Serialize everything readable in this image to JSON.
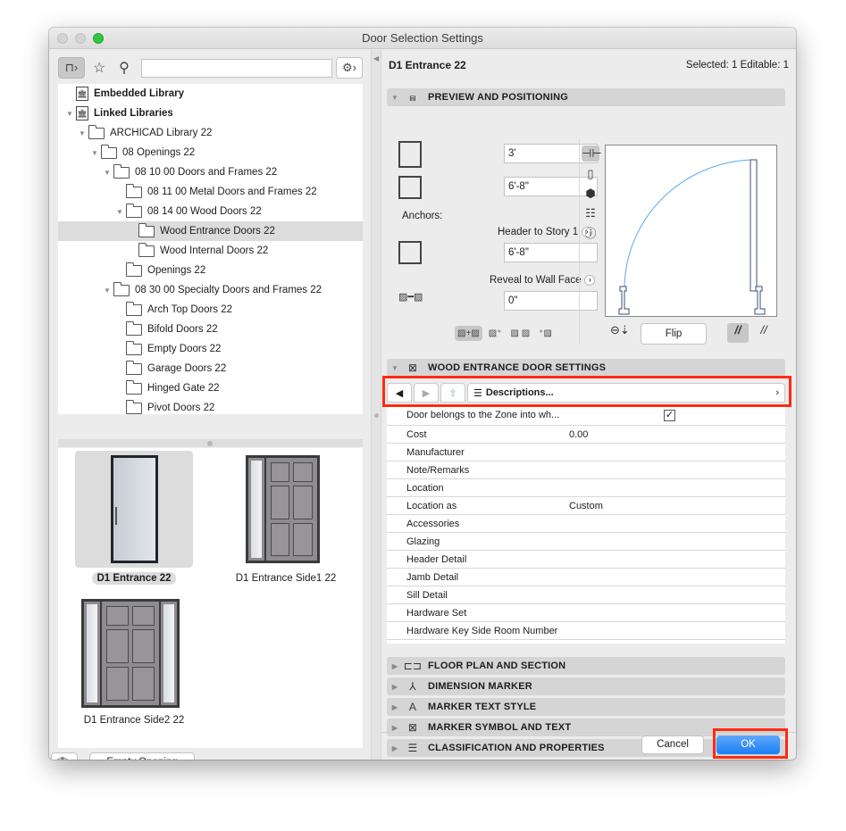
{
  "window": {
    "title": "Door Selection Settings"
  },
  "left": {
    "search": {
      "value": "",
      "placeholder": ""
    },
    "tree": [
      {
        "label": "Embedded Library",
        "level": 0,
        "bold": true,
        "expanded": null,
        "icon": "library-file-icon"
      },
      {
        "label": "Linked Libraries",
        "level": 0,
        "bold": true,
        "expanded": true,
        "icon": "library-folder-icon"
      },
      {
        "label": "ARCHICAD Library 22",
        "level": 1,
        "expanded": true
      },
      {
        "label": "08 Openings 22",
        "level": 2,
        "expanded": true
      },
      {
        "label": "08 10 00 Doors and Frames 22",
        "level": 3,
        "expanded": true
      },
      {
        "label": "08 11 00 Metal Doors and Frames 22",
        "level": 4,
        "expanded": null
      },
      {
        "label": "08 14 00 Wood Doors 22",
        "level": 4,
        "expanded": true
      },
      {
        "label": "Wood Entrance Doors 22",
        "level": 5,
        "expanded": null,
        "selected": true
      },
      {
        "label": "Wood Internal Doors 22",
        "level": 5,
        "expanded": null
      },
      {
        "label": "Openings 22",
        "level": 4,
        "expanded": null
      },
      {
        "label": "08 30 00 Specialty Doors and Frames 22",
        "level": 3,
        "expanded": true
      },
      {
        "label": "Arch Top Doors 22",
        "level": 4,
        "expanded": null
      },
      {
        "label": "Bifold Doors 22",
        "level": 4,
        "expanded": null
      },
      {
        "label": "Empty Doors 22",
        "level": 4,
        "expanded": null
      },
      {
        "label": "Garage Doors 22",
        "level": 4,
        "expanded": null
      },
      {
        "label": "Hinged Gate 22",
        "level": 4,
        "expanded": null
      },
      {
        "label": "Pivot Doors 22",
        "level": 4,
        "expanded": null
      }
    ],
    "thumbnails": [
      {
        "label": "D1 Entrance 22",
        "selected": true
      },
      {
        "label": "D1 Entrance Side1 22",
        "selected": false
      },
      {
        "label": "D1 Entrance Side2 22",
        "selected": false
      }
    ],
    "empty_opening_label": "Empty Opening"
  },
  "right": {
    "element_name": "D1 Entrance 22",
    "selection_info": "Selected: 1 Editable: 1",
    "preview_section": {
      "title": "PREVIEW AND POSITIONING",
      "width": "3'",
      "height": "6'-8\"",
      "anchors_label": "Anchors:",
      "header_anchor_label": "Header to Story 1",
      "header_value": "6'-8\"",
      "reveal_label": "Reveal to Wall Face",
      "reveal_value": "0\"",
      "flip_label": "Flip"
    },
    "settings_section": {
      "title": "WOOD ENTRANCE DOOR SETTINGS",
      "page_label": "Descriptions...",
      "rows": [
        {
          "name": "Door belongs to the Zone into wh...",
          "value": "",
          "checkbox": true,
          "checked": true
        },
        {
          "name": "Cost",
          "value": "0.00"
        },
        {
          "name": "Manufacturer",
          "value": ""
        },
        {
          "name": "Note/Remarks",
          "value": ""
        },
        {
          "name": "Location",
          "value": ""
        },
        {
          "name": "Location as",
          "value": "Custom"
        },
        {
          "name": "Accessories",
          "value": ""
        },
        {
          "name": "Glazing",
          "value": ""
        },
        {
          "name": "Header Detail",
          "value": ""
        },
        {
          "name": "Jamb Detail",
          "value": ""
        },
        {
          "name": "Sill Detail",
          "value": ""
        },
        {
          "name": "Hardware Set",
          "value": ""
        },
        {
          "name": "Hardware Key Side Room Number",
          "value": ""
        }
      ]
    },
    "collapsed_sections": [
      {
        "title": "FLOOR PLAN AND SECTION",
        "icon": "floor-plan-icon",
        "glyph": "⊏⊐"
      },
      {
        "title": "DIMENSION MARKER",
        "icon": "dimension-marker-icon",
        "glyph": "⅄"
      },
      {
        "title": "MARKER TEXT STYLE",
        "icon": "marker-text-icon",
        "glyph": "A"
      },
      {
        "title": "MARKER SYMBOL AND TEXT",
        "icon": "marker-symbol-icon",
        "glyph": "⊠"
      },
      {
        "title": "CLASSIFICATION AND PROPERTIES",
        "icon": "classification-icon",
        "glyph": "☰"
      }
    ],
    "cancel_label": "Cancel",
    "ok_label": "OK"
  },
  "colors": {
    "highlight": "#ff2a12",
    "ok_button": "#1b7ff4",
    "swing_arc": "#5aa9ee"
  }
}
